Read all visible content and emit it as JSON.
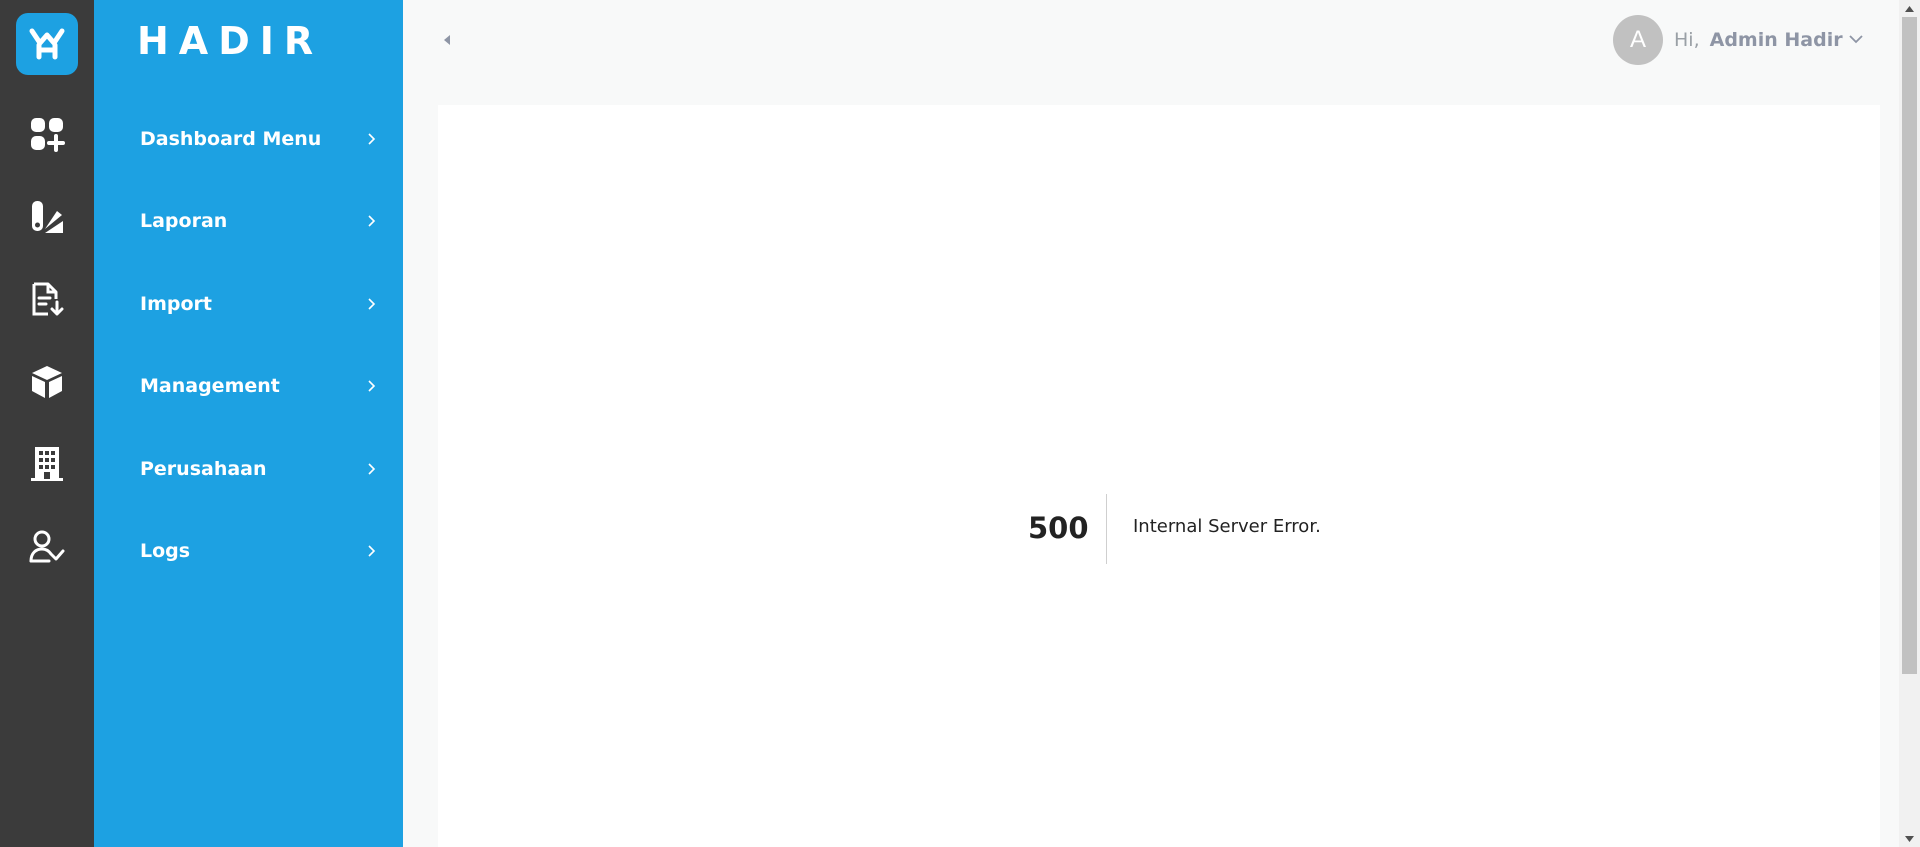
{
  "brand": {
    "name": "HADIR",
    "accent": "#1da1e2",
    "rail_bg": "#3b3b3b"
  },
  "rail": {
    "icons": [
      "dashboard-add-icon",
      "report-chart-icon",
      "file-import-icon",
      "package-box-icon",
      "office-building-icon",
      "user-check-icon"
    ]
  },
  "menu": {
    "items": [
      {
        "label": "Dashboard Menu"
      },
      {
        "label": "Laporan"
      },
      {
        "label": "Import"
      },
      {
        "label": "Management"
      },
      {
        "label": "Perusahaan"
      },
      {
        "label": "Logs"
      }
    ]
  },
  "header": {
    "avatar_initial": "A",
    "greeting": "Hi,",
    "user_name": "Admin Hadir"
  },
  "error": {
    "code": "500",
    "message": "Internal Server Error."
  }
}
